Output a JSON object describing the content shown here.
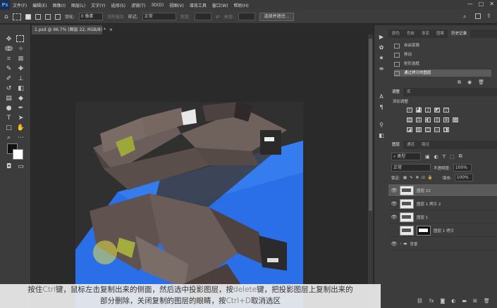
{
  "menubar": {
    "logo": "Ps",
    "items": [
      "文件(F)",
      "编辑(E)",
      "图像(I)",
      "图层(L)",
      "文字(Y)",
      "选择(S)",
      "滤镜(T)",
      "3D(D)",
      "视图(V)",
      "增效工具",
      "窗口(W)",
      "帮助(H)"
    ],
    "controls": [
      "—",
      "□",
      "✕"
    ]
  },
  "options": {
    "feather_label": "羽化:",
    "feather_value": "0 像素",
    "antialias_label": "消除锯齿",
    "style_label": "样式:",
    "style_value": "正常",
    "width_label": "宽度:",
    "height_label": "高度:",
    "select_mask_button": "选择并遮住..."
  },
  "document": {
    "tab_title": "1.psd @ 96.7% (图层 22, RGB/8) *",
    "tab_close": "×",
    "zoom_status": "96.7%"
  },
  "panels": {
    "top_tabs": [
      "颜色",
      "色板",
      "渐变",
      "图案",
      "历史记录"
    ],
    "history": [
      "自由变换",
      "移动",
      "矩形选框",
      "通过拷贝的图层"
    ],
    "adjust_tabs": [
      "调整",
      "库"
    ],
    "adjust_title": "添加调整",
    "layers_tabs": [
      "图层",
      "通道",
      "路径"
    ],
    "filter_kind": "类型",
    "blend_mode": "正常",
    "opacity_label": "不透明度:",
    "opacity_value": "100%",
    "lock_label": "锁定:",
    "fill_label": "填充:",
    "fill_value": "100%",
    "layers": [
      {
        "name": "图层 22",
        "visible": true,
        "selected": true
      },
      {
        "name": "图层 1 拷贝 2",
        "visible": true,
        "selected": false
      },
      {
        "name": "图层 1",
        "visible": true,
        "selected": false
      },
      {
        "name": "图层 1 拷贝",
        "visible": false,
        "selected": false
      },
      {
        "name": "背景",
        "visible": true,
        "selected": false
      }
    ]
  },
  "caption": {
    "line1_a": "按住",
    "line1_key1": "Ctrl",
    "line1_b": "键，鼠标左击复制出来的侧面，然后选中投影图层，按",
    "line1_key2": "delete",
    "line1_c": "键，把投影图层上复制出来的",
    "line2_a": "部分删除，关闭复制的图层的眼睛，按",
    "line2_key": "Ctrl+D",
    "line2_b": "取消选区"
  },
  "colors": {
    "accent_blue": "#2a6fe8",
    "highlight_yellow": "#e8e04a"
  }
}
